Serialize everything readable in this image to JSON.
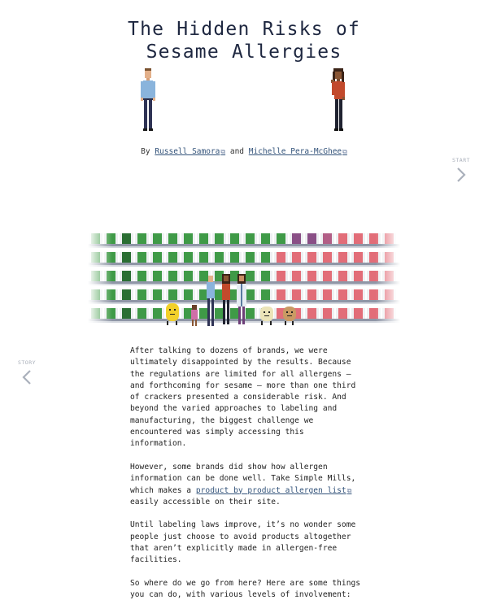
{
  "title": {
    "line1": "The Hidden Risks of",
    "line2": "Sesame Allergies"
  },
  "byline": {
    "prefix": "By",
    "author1": "Russell Samora",
    "conjunction": "and",
    "author2": "Michelle Pera-McGhee"
  },
  "nav": {
    "right_label": "START",
    "left_label": "STORY"
  },
  "icons": {
    "external_link": "external-link-icon",
    "chevron_right": "chevron-right-icon",
    "chevron_left": "chevron-left-icon"
  },
  "colors": {
    "green": "#3f9a47",
    "dark_green": "#2a6e33",
    "purple": "#8a4f86",
    "pink": "#e26d78",
    "link": "#33537a"
  },
  "body": {
    "p1": "After talking to dozens of brands, we were ultimately disappointed by the results. Because the regulations are limited for all allergens — and forthcoming for sesame — more than one third of crackers presented a considerable risk. And beyond the varied approaches to labeling and manufacturing, the biggest challenge we encountered was simply accessing this information.",
    "p2_before": "However, some brands did show how allergen information can be done well. Take Simple Mills, which makes a ",
    "p2_link": "product by product allergen list",
    "p2_after": " easily accessible on their site.",
    "p3": "Until labeling laws improve, it’s no wonder some people just choose to avoid products altogether that aren’t explicitly made in allergen-free facilities.",
    "p4": "So where do we go from here? Here are some things you can do, with various levels of involvement:"
  }
}
